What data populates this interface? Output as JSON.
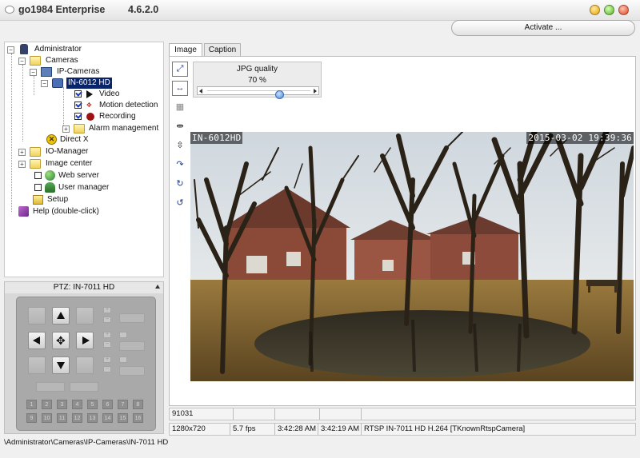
{
  "window": {
    "title": "go1984 Enterprise",
    "version": "4.6.2.0",
    "activate_label": "Activate ..."
  },
  "tree": {
    "administrator": "Administrator",
    "cameras": "Cameras",
    "ip_cameras": "IP-Cameras",
    "camera_selected": "IN-6012 HD",
    "video": "Video",
    "motion_detection": "Motion detection",
    "recording": "Recording",
    "alarm_management": "Alarm management",
    "direct_x": "Direct X",
    "io_manager": "IO-Manager",
    "image_center": "Image center",
    "web_server": "Web server",
    "user_manager": "User manager",
    "setup": "Setup",
    "help": "Help (double-click)"
  },
  "ptz": {
    "title": "PTZ: IN-7011 HD",
    "presets": [
      "1",
      "2",
      "3",
      "4",
      "5",
      "6",
      "7",
      "8",
      "9",
      "10",
      "11",
      "12",
      "13",
      "14",
      "15",
      "16"
    ]
  },
  "tabs": [
    {
      "label": "Image",
      "active": true
    },
    {
      "label": "Caption",
      "active": false
    }
  ],
  "jpg": {
    "label": "JPG quality",
    "value_text": "70 %",
    "value": 70
  },
  "image": {
    "osd_camera": "IN-6012HD",
    "osd_timestamp": "2015-03-02  19:39:36"
  },
  "status_line1": {
    "counter": "91031",
    "cells": [
      "",
      "",
      "",
      ""
    ]
  },
  "status_line2": {
    "resolution": "1280x720",
    "fps": "5.7 fps",
    "time1": "3:42:28 AM",
    "time2": "3:42:19 AM",
    "stream": "RTSP IN-7011 HD H.264 [TKnownRtspCamera]"
  },
  "path": "\\Administrator\\Cameras\\IP-Cameras\\IN-7011 HD"
}
